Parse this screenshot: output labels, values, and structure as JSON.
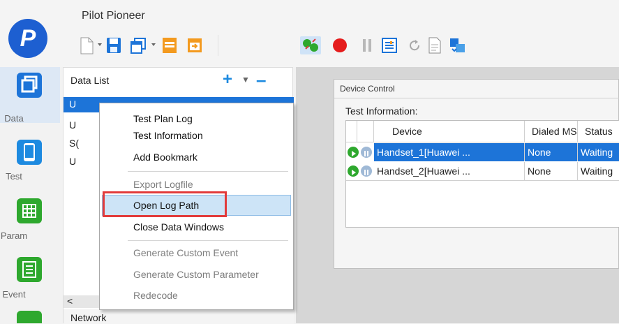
{
  "app": {
    "title": "Pilot Pioneer",
    "logo_letter": "P"
  },
  "toolbar": {
    "icons": [
      "new-file-icon",
      "save-icon",
      "copy-window-icon",
      "open-folder-icon",
      "export-folder-icon",
      "connect-devices-icon",
      "record-icon",
      "pause-icon",
      "list-settings-icon",
      "refresh-icon",
      "report-icon",
      "transfer-icon"
    ]
  },
  "nav": {
    "items": [
      {
        "label": "Data",
        "icon": "data-icon",
        "color": "#1d74d8"
      },
      {
        "label": "Test",
        "icon": "test-icon",
        "color": "#1d8ae0"
      },
      {
        "label": "Param",
        "icon": "param-icon",
        "color": "#2ea82e"
      },
      {
        "label": "Event",
        "icon": "event-icon",
        "color": "#2ea82e"
      }
    ]
  },
  "data_list": {
    "title": "Data List",
    "items": [
      "U",
      "U",
      "S(",
      "U"
    ],
    "network_label": "Network",
    "scroll_left": "<",
    "dots": "...."
  },
  "context_menu": {
    "items": [
      {
        "label": "Test Plan Log",
        "enabled": true
      },
      {
        "label": "Test Information",
        "enabled": true
      },
      {
        "label": "Add Bookmark",
        "enabled": true
      },
      {
        "label": "Export Logfile",
        "enabled": false
      },
      {
        "label": "Open Log Path",
        "enabled": true,
        "highlighted": true
      },
      {
        "label": "Close Data Windows",
        "enabled": true
      },
      {
        "label": "Generate Custom Event",
        "enabled": false
      },
      {
        "label": "Generate Custom Parameter",
        "enabled": false
      },
      {
        "label": "Redecode",
        "enabled": false
      }
    ]
  },
  "device_control": {
    "title": "Device Control",
    "section_label": "Test Information:",
    "columns": [
      "Device",
      "Dialed MS",
      "Status"
    ],
    "rows": [
      {
        "device": "Handset_1[Huawei ...",
        "dialed_ms": "None",
        "status": "Waiting",
        "selected": true
      },
      {
        "device": "Handset_2[Huawei ...",
        "dialed_ms": "None",
        "status": "Waiting",
        "selected": false
      }
    ]
  },
  "colors": {
    "accent": "#1d74d8",
    "highlight_box": "#e23b3b",
    "play_green": "#2ea82e"
  }
}
